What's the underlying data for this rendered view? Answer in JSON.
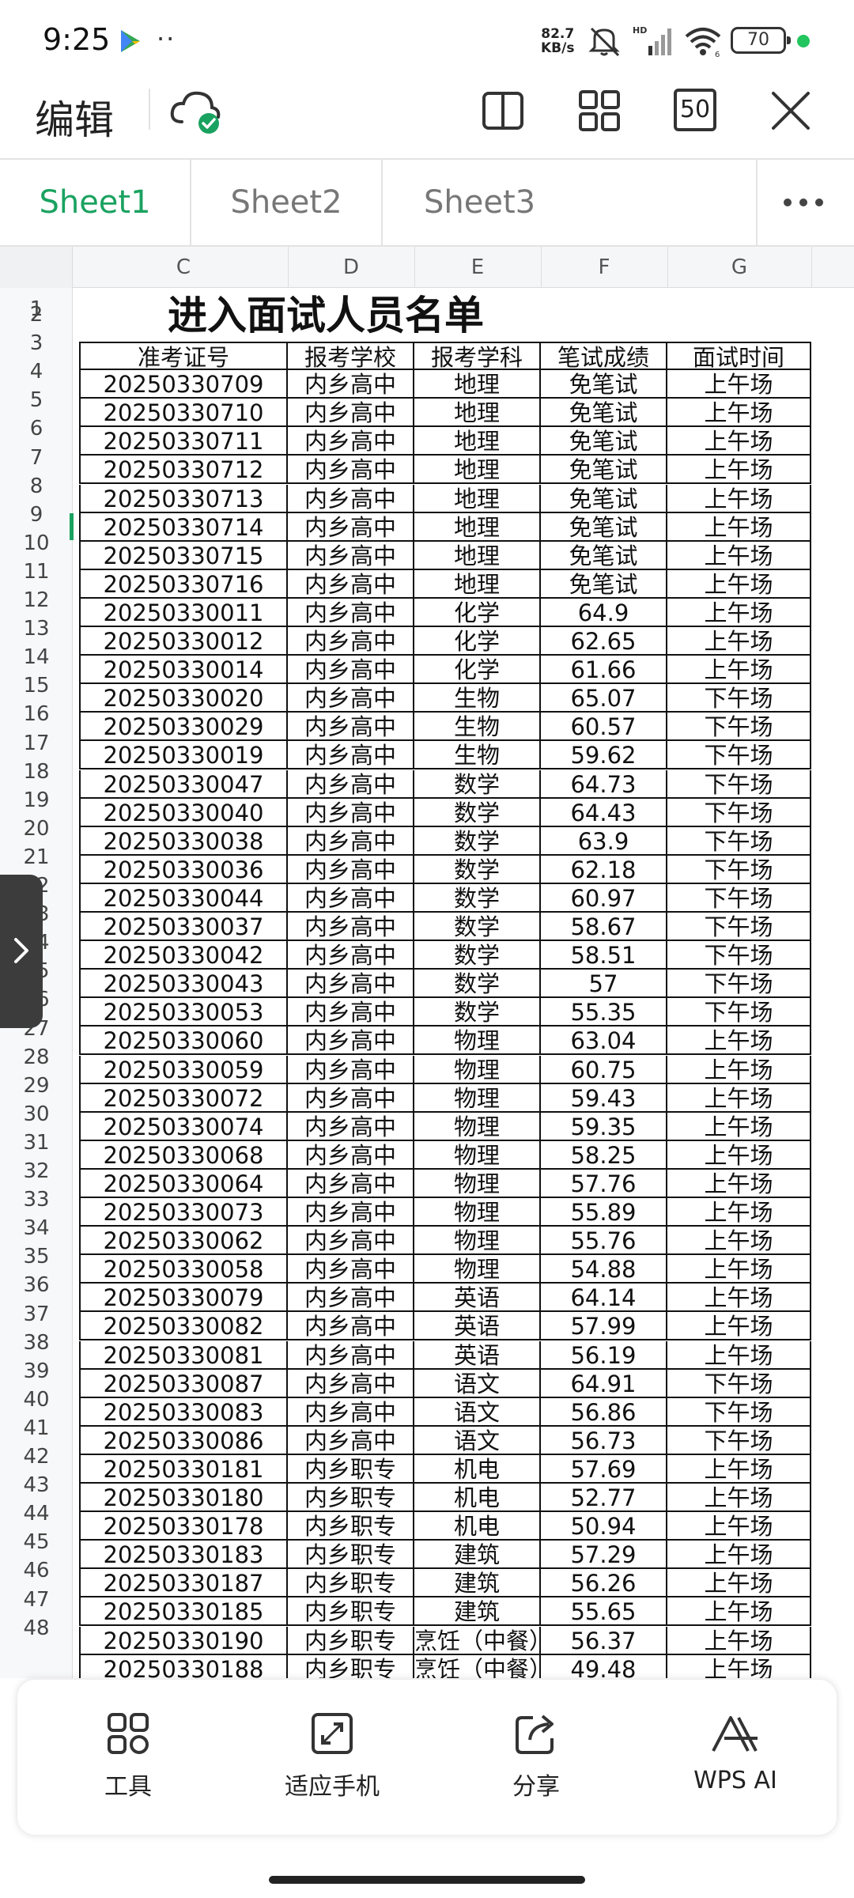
{
  "status": {
    "time": "9:25",
    "dots": "··",
    "speed_value": "82.7",
    "speed_unit": "KB/s",
    "battery": "70"
  },
  "toolbar": {
    "edit_label": "编辑",
    "zoom_label": "50"
  },
  "tabs": [
    {
      "label": "Sheet1",
      "active": true
    },
    {
      "label": "Sheet2",
      "active": false
    },
    {
      "label": "Sheet3",
      "active": false
    }
  ],
  "columns": [
    "C",
    "D",
    "E",
    "F",
    "G"
  ],
  "sheet": {
    "title": "进入面试人员名单",
    "header_row_num": "2",
    "headers": [
      "准考证号",
      "报考学校",
      "报考学科",
      "笔试成绩",
      "面试时间"
    ],
    "selected_row": "8",
    "rows": [
      {
        "n": "3",
        "id": "20250330709",
        "school": "内乡高中",
        "subject": "地理",
        "score": "免笔试",
        "time": "上午场"
      },
      {
        "n": "4",
        "id": "20250330710",
        "school": "内乡高中",
        "subject": "地理",
        "score": "免笔试",
        "time": "上午场"
      },
      {
        "n": "5",
        "id": "20250330711",
        "school": "内乡高中",
        "subject": "地理",
        "score": "免笔试",
        "time": "上午场"
      },
      {
        "n": "6",
        "id": "20250330712",
        "school": "内乡高中",
        "subject": "地理",
        "score": "免笔试",
        "time": "上午场"
      },
      {
        "n": "7",
        "id": "20250330713",
        "school": "内乡高中",
        "subject": "地理",
        "score": "免笔试",
        "time": "上午场"
      },
      {
        "n": "8",
        "id": "20250330714",
        "school": "内乡高中",
        "subject": "地理",
        "score": "免笔试",
        "time": "上午场"
      },
      {
        "n": "9",
        "id": "20250330715",
        "school": "内乡高中",
        "subject": "地理",
        "score": "免笔试",
        "time": "上午场"
      },
      {
        "n": "10",
        "id": "20250330716",
        "school": "内乡高中",
        "subject": "地理",
        "score": "免笔试",
        "time": "上午场"
      },
      {
        "n": "11",
        "id": "20250330011",
        "school": "内乡高中",
        "subject": "化学",
        "score": "64.9",
        "time": "上午场"
      },
      {
        "n": "12",
        "id": "20250330012",
        "school": "内乡高中",
        "subject": "化学",
        "score": "62.65",
        "time": "上午场"
      },
      {
        "n": "13",
        "id": "20250330014",
        "school": "内乡高中",
        "subject": "化学",
        "score": "61.66",
        "time": "上午场"
      },
      {
        "n": "14",
        "id": "20250330020",
        "school": "内乡高中",
        "subject": "生物",
        "score": "65.07",
        "time": "下午场"
      },
      {
        "n": "15",
        "id": "20250330029",
        "school": "内乡高中",
        "subject": "生物",
        "score": "60.57",
        "time": "下午场"
      },
      {
        "n": "16",
        "id": "20250330019",
        "school": "内乡高中",
        "subject": "生物",
        "score": "59.62",
        "time": "下午场"
      },
      {
        "n": "17",
        "id": "20250330047",
        "school": "内乡高中",
        "subject": "数学",
        "score": "64.73",
        "time": "下午场"
      },
      {
        "n": "18",
        "id": "20250330040",
        "school": "内乡高中",
        "subject": "数学",
        "score": "64.43",
        "time": "下午场"
      },
      {
        "n": "19",
        "id": "20250330038",
        "school": "内乡高中",
        "subject": "数学",
        "score": "63.9",
        "time": "下午场"
      },
      {
        "n": "20",
        "id": "20250330036",
        "school": "内乡高中",
        "subject": "数学",
        "score": "62.18",
        "time": "下午场"
      },
      {
        "n": "21",
        "id": "20250330044",
        "school": "内乡高中",
        "subject": "数学",
        "score": "60.97",
        "time": "下午场"
      },
      {
        "n": "22",
        "id": "20250330037",
        "school": "内乡高中",
        "subject": "数学",
        "score": "58.67",
        "time": "下午场"
      },
      {
        "n": "23",
        "id": "20250330042",
        "school": "内乡高中",
        "subject": "数学",
        "score": "58.51",
        "time": "下午场"
      },
      {
        "n": "24",
        "id": "20250330043",
        "school": "内乡高中",
        "subject": "数学",
        "score": "57",
        "time": "下午场"
      },
      {
        "n": "25",
        "id": "20250330053",
        "school": "内乡高中",
        "subject": "数学",
        "score": "55.35",
        "time": "下午场"
      },
      {
        "n": "26",
        "id": "20250330060",
        "school": "内乡高中",
        "subject": "物理",
        "score": "63.04",
        "time": "上午场"
      },
      {
        "n": "27",
        "id": "20250330059",
        "school": "内乡高中",
        "subject": "物理",
        "score": "60.75",
        "time": "上午场"
      },
      {
        "n": "28",
        "id": "20250330072",
        "school": "内乡高中",
        "subject": "物理",
        "score": "59.43",
        "time": "上午场"
      },
      {
        "n": "29",
        "id": "20250330074",
        "school": "内乡高中",
        "subject": "物理",
        "score": "59.35",
        "time": "上午场"
      },
      {
        "n": "30",
        "id": "20250330068",
        "school": "内乡高中",
        "subject": "物理",
        "score": "58.25",
        "time": "上午场"
      },
      {
        "n": "31",
        "id": "20250330064",
        "school": "内乡高中",
        "subject": "物理",
        "score": "57.76",
        "time": "上午场"
      },
      {
        "n": "32",
        "id": "20250330073",
        "school": "内乡高中",
        "subject": "物理",
        "score": "55.89",
        "time": "上午场"
      },
      {
        "n": "33",
        "id": "20250330062",
        "school": "内乡高中",
        "subject": "物理",
        "score": "55.76",
        "time": "上午场"
      },
      {
        "n": "34",
        "id": "20250330058",
        "school": "内乡高中",
        "subject": "物理",
        "score": "54.88",
        "time": "上午场"
      },
      {
        "n": "35",
        "id": "20250330079",
        "school": "内乡高中",
        "subject": "英语",
        "score": "64.14",
        "time": "上午场"
      },
      {
        "n": "36",
        "id": "20250330082",
        "school": "内乡高中",
        "subject": "英语",
        "score": "57.99",
        "time": "上午场"
      },
      {
        "n": "37",
        "id": "20250330081",
        "school": "内乡高中",
        "subject": "英语",
        "score": "56.19",
        "time": "上午场"
      },
      {
        "n": "38",
        "id": "20250330087",
        "school": "内乡高中",
        "subject": "语文",
        "score": "64.91",
        "time": "下午场"
      },
      {
        "n": "39",
        "id": "20250330083",
        "school": "内乡高中",
        "subject": "语文",
        "score": "56.86",
        "time": "下午场"
      },
      {
        "n": "40",
        "id": "20250330086",
        "school": "内乡高中",
        "subject": "语文",
        "score": "56.73",
        "time": "下午场"
      },
      {
        "n": "41",
        "id": "20250330181",
        "school": "内乡职专",
        "subject": "机电",
        "score": "57.69",
        "time": "上午场"
      },
      {
        "n": "42",
        "id": "20250330180",
        "school": "内乡职专",
        "subject": "机电",
        "score": "52.77",
        "time": "上午场"
      },
      {
        "n": "43",
        "id": "20250330178",
        "school": "内乡职专",
        "subject": "机电",
        "score": "50.94",
        "time": "上午场"
      },
      {
        "n": "44",
        "id": "20250330183",
        "school": "内乡职专",
        "subject": "建筑",
        "score": "57.29",
        "time": "上午场"
      },
      {
        "n": "45",
        "id": "20250330187",
        "school": "内乡职专",
        "subject": "建筑",
        "score": "56.26",
        "time": "上午场"
      },
      {
        "n": "46",
        "id": "20250330185",
        "school": "内乡职专",
        "subject": "建筑",
        "score": "55.65",
        "time": "上午场"
      },
      {
        "n": "47",
        "id": "20250330190",
        "school": "内乡职专",
        "subject": "烹饪（中餐）",
        "score": "56.37",
        "time": "上午场"
      },
      {
        "n": "48",
        "id": "20250330188",
        "school": "内乡职专",
        "subject": "烹饪（中餐）",
        "score": "49.48",
        "time": "上午场"
      }
    ]
  },
  "bottom_bar": {
    "tools": "工具",
    "fit_phone": "适应手机",
    "share": "分享",
    "wps_ai": "WPS AI"
  },
  "colors": {
    "accent_green": "#1aa260"
  }
}
